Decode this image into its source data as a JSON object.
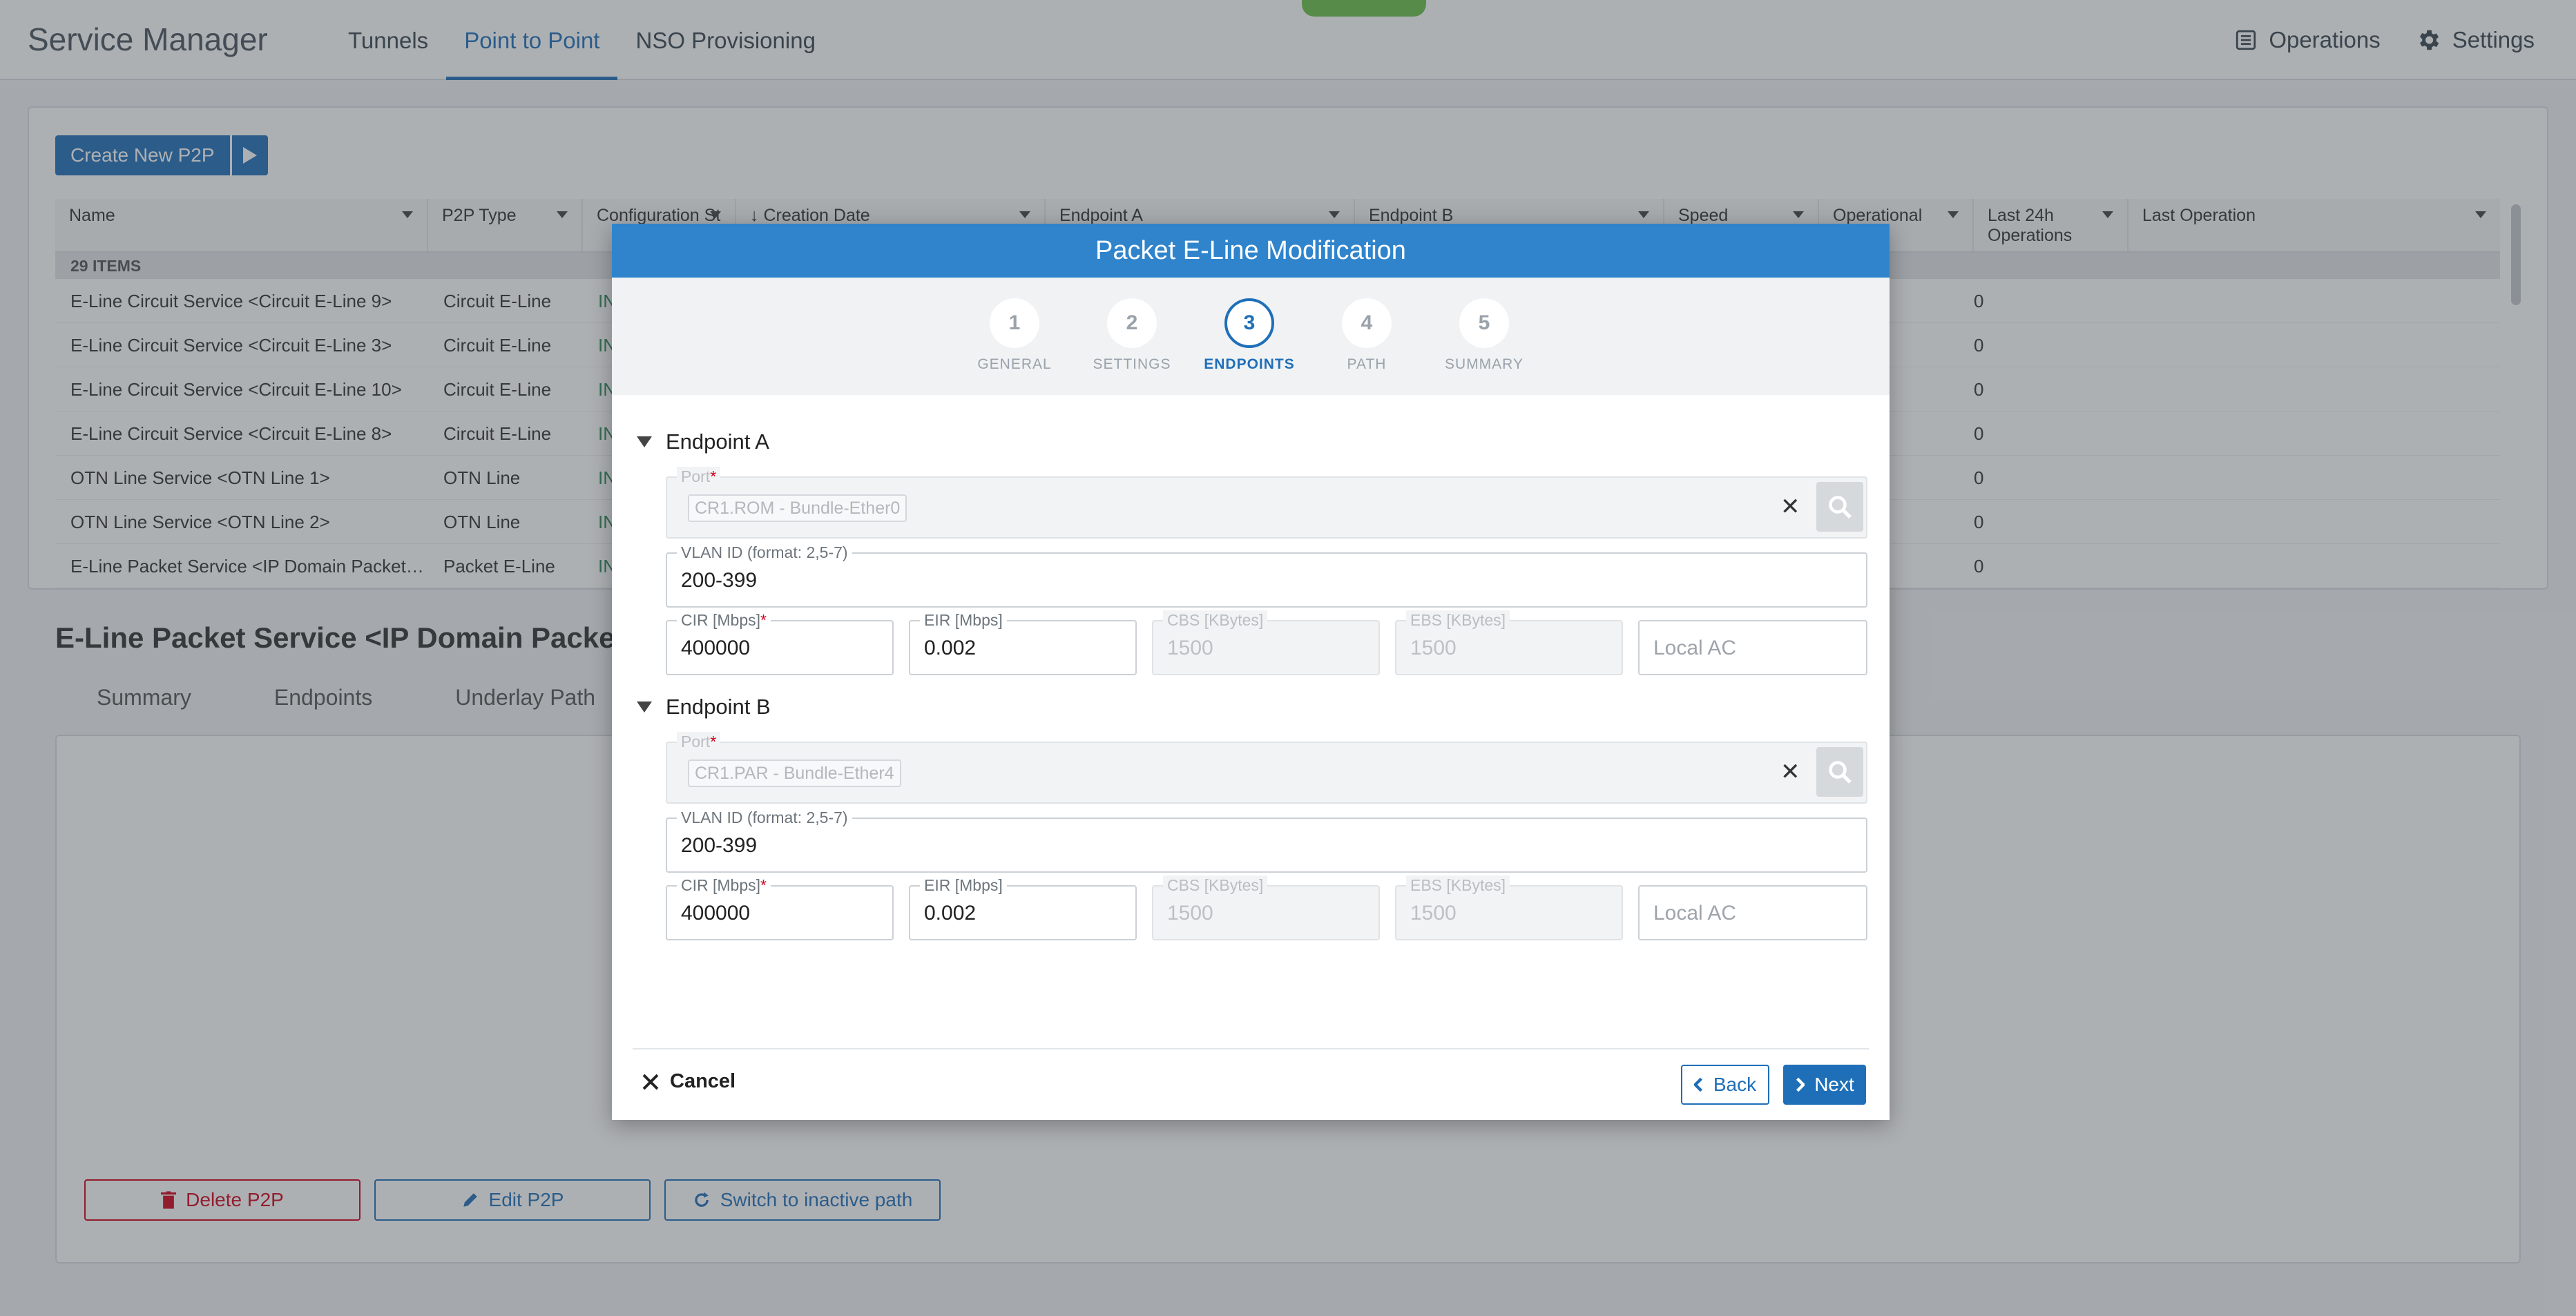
{
  "header": {
    "app_title": "Service Manager",
    "tabs": [
      {
        "label": "Tunnels"
      },
      {
        "label": "Point to Point"
      },
      {
        "label": "NSO Provisioning"
      }
    ],
    "active_tab": "Point to Point",
    "operations_label": "Operations",
    "settings_label": "Settings"
  },
  "list": {
    "create_button": "Create New P2P",
    "items_count": "29 ITEMS",
    "columns": [
      "Name",
      "P2P Type",
      "Configuration St",
      "Creation Date",
      "Endpoint A",
      "Endpoint B",
      "Speed",
      "Operational",
      "Last 24h Operations",
      "Last Operation"
    ],
    "rows": [
      {
        "name": "E-Line Circuit Service <Circuit E-Line 9>",
        "type": "Circuit E-Line",
        "config": "IN",
        "ops": "0"
      },
      {
        "name": "E-Line Circuit Service <Circuit E-Line 3>",
        "type": "Circuit E-Line",
        "config": "IN",
        "ops": "0"
      },
      {
        "name": "E-Line Circuit Service <Circuit E-Line 10>",
        "type": "Circuit E-Line",
        "config": "IN",
        "ops": "0"
      },
      {
        "name": "E-Line Circuit Service <Circuit E-Line 8>",
        "type": "Circuit E-Line",
        "config": "IN",
        "ops": "0"
      },
      {
        "name": "OTN Line Service <OTN Line 1>",
        "type": "OTN Line",
        "config": "IN",
        "ops": "0"
      },
      {
        "name": "OTN Line Service <OTN Line 2>",
        "type": "OTN Line",
        "config": "IN",
        "ops": "0"
      },
      {
        "name": "E-Line Packet Service <IP Domain Packet…",
        "type": "Packet E-Line",
        "config": "IN",
        "ops": "0"
      }
    ]
  },
  "detail": {
    "title": "E-Line Packet Service <IP Domain Packet E-L",
    "tabs": [
      "Summary",
      "Endpoints",
      "Underlay Path"
    ],
    "delete_button": "Delete P2P",
    "edit_button": "Edit P2P",
    "switch_button": "Switch to inactive path"
  },
  "modal": {
    "title": "Packet E-Line Modification",
    "steps": [
      {
        "number": "1",
        "label": "GENERAL"
      },
      {
        "number": "2",
        "label": "SETTINGS"
      },
      {
        "number": "3",
        "label": "ENDPOINTS"
      },
      {
        "number": "4",
        "label": "PATH"
      },
      {
        "number": "5",
        "label": "SUMMARY"
      }
    ],
    "active_step": 3,
    "endpoint_a": {
      "title": "Endpoint A",
      "port_label": "Port",
      "port_value": "CR1.ROM - Bundle-Ether0",
      "vlan_label": "VLAN ID (format: 2,5-7)",
      "vlan_value": "200-399",
      "cir_label": "CIR [Mbps]",
      "cir_value": "400000",
      "eir_label": "EIR [Mbps]",
      "eir_value": "0.002",
      "cbs_label": "CBS [KBytes]",
      "cbs_value": "1500",
      "ebs_label": "EBS [KBytes]",
      "ebs_value": "1500",
      "local_ac_placeholder": "Local AC"
    },
    "endpoint_b": {
      "title": "Endpoint B",
      "port_label": "Port",
      "port_value": "CR1.PAR - Bundle-Ether4",
      "vlan_label": "VLAN ID (format: 2,5-7)",
      "vlan_value": "200-399",
      "cir_label": "CIR [Mbps]",
      "cir_value": "400000",
      "eir_label": "EIR [Mbps]",
      "eir_value": "0.002",
      "cbs_label": "CBS [KBytes]",
      "cbs_value": "1500",
      "ebs_label": "EBS [KBytes]",
      "ebs_value": "1500",
      "local_ac_placeholder": "Local AC"
    },
    "cancel_label": "Cancel",
    "back_label": "Back",
    "next_label": "Next"
  },
  "colors": {
    "primary": "#1f6fb8",
    "modal_header": "#2f84cc",
    "danger": "#d0021b",
    "config_status": "#2e8b57"
  }
}
